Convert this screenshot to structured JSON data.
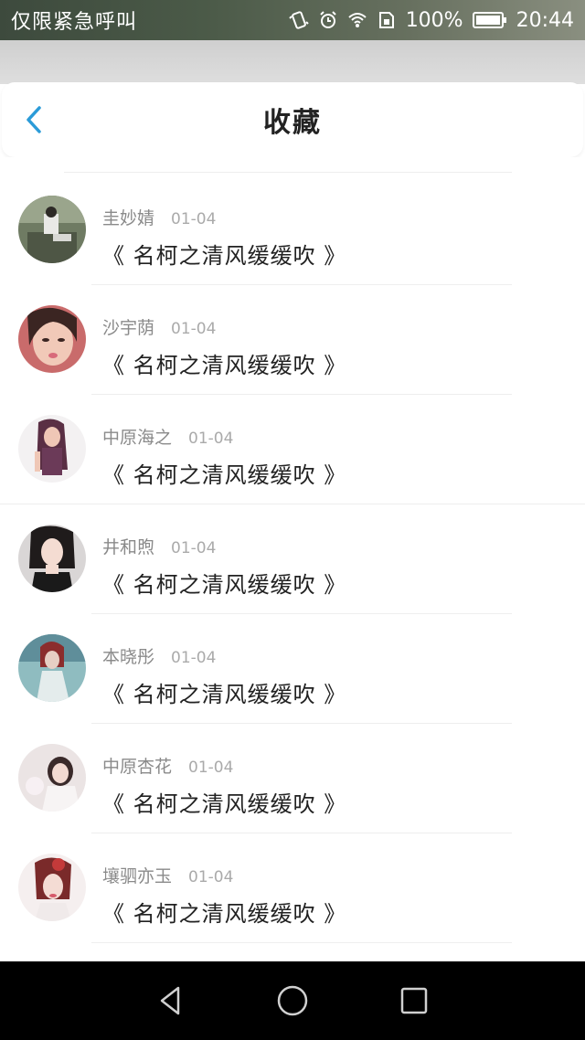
{
  "status_bar": {
    "carrier": "仅限紧急呼叫",
    "battery_percent": "100%",
    "time": "20:44",
    "icons": [
      "vibrate-icon",
      "alarm-icon",
      "wifi-icon",
      "sim-icon",
      "battery-icon"
    ]
  },
  "header": {
    "title": "收藏",
    "back_icon": "chevron-left-icon",
    "accent": "#2b9bd8"
  },
  "favorites": [
    {
      "author": "圭妙婧",
      "date": "01-04",
      "title": "《 名柯之清风缓缓吹 》",
      "avatar": "avatar-photo-1"
    },
    {
      "author": "沙宇荫",
      "date": "01-04",
      "title": "《 名柯之清风缓缓吹 》",
      "avatar": "avatar-photo-2"
    },
    {
      "author": "中原海之",
      "date": "01-04",
      "title": "《 名柯之清风缓缓吹 》",
      "avatar": "avatar-photo-3"
    },
    {
      "author": "井和煦",
      "date": "01-04",
      "title": "《 名柯之清风缓缓吹 》",
      "avatar": "avatar-photo-4"
    },
    {
      "author": "本晓彤",
      "date": "01-04",
      "title": "《 名柯之清风缓缓吹 》",
      "avatar": "avatar-photo-5"
    },
    {
      "author": "中原杏花",
      "date": "01-04",
      "title": "《 名柯之清风缓缓吹 》",
      "avatar": "avatar-photo-6"
    },
    {
      "author": "壤驷亦玉",
      "date": "01-04",
      "title": "《 名柯之清风缓缓吹 》",
      "avatar": "avatar-photo-7"
    }
  ],
  "nav_bar": {
    "icons": [
      "back-triangle-icon",
      "home-circle-icon",
      "recents-square-icon"
    ]
  }
}
